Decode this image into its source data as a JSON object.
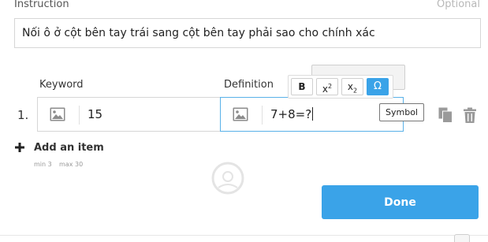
{
  "instruction": {
    "label": "Instruction",
    "optional_label": "Optional",
    "value": "Nối ô ở cột bên tay trái sang cột bên tay phải sao cho chính xác"
  },
  "columns": {
    "keyword": "Keyword",
    "definition": "Definition"
  },
  "item": {
    "number": "1.",
    "keyword_value": "15",
    "definition_value": "7+8=?"
  },
  "toolbar": {
    "bold": "B",
    "superscript_base": "x",
    "superscript_exp": "2",
    "subscript_base": "x",
    "subscript_exp": "2",
    "symbol_glyph": "Ω"
  },
  "tooltip": {
    "text": "Symbol"
  },
  "add_item": {
    "label": "Add an item",
    "min": "min 3",
    "max": "max 30"
  },
  "done_button": {
    "label": "Done"
  },
  "colors": {
    "accent": "#3aa3e8",
    "focus_border": "#59b1e8"
  },
  "icons": [
    "image-icon",
    "copy-icon",
    "trash-icon",
    "plus-icon",
    "watermark-logo"
  ]
}
